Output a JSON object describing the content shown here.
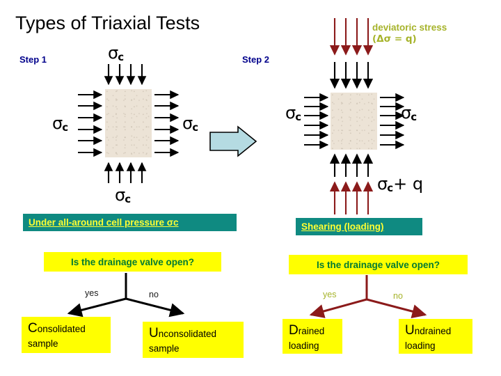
{
  "slide": {
    "title": "Types of Triaxial Tests",
    "background": "#ffffff"
  },
  "colors": {
    "title_text": "#000000",
    "step_label": "#00008b",
    "sample_fill": "#ece3d6",
    "black_arrow": "#000000",
    "dark_red_arrow": "#8b1a1a",
    "transition_arrow_fill": "#b5dbe2",
    "banner_bg": "#0f8a81",
    "banner_text": "#ffff33",
    "question_bg": "#ffff00",
    "question_text": "#007a33",
    "leaf_bg": "#ffff00",
    "leaf_text": "#000000",
    "deviatoric_text": "#a6b32a"
  },
  "step1": {
    "label": "Step 1",
    "sigma_top": "σc",
    "sigma_left": "σc",
    "sigma_right": "σc",
    "sigma_bottom": "σc",
    "top_arrow_count": 4,
    "side_arrow_count": 6,
    "bottom_arrow_count": 4,
    "arrow_color": "#000000"
  },
  "step2": {
    "label": "Step 2",
    "sigma_left": "σc",
    "sigma_right": "σc",
    "sigma_bottom": "σc+ q",
    "deviatoric_line1": "deviatoric stress",
    "deviatoric_line2": "(Δσ = q)",
    "top_red_arrow_count": 4,
    "top_black_arrow_count": 4,
    "side_arrow_count": 6,
    "bottom_black_arrow_count": 4,
    "bottom_red_arrow_count": 4
  },
  "transition_arrow": {
    "name": "right-arrow-shape",
    "fill": "#b5dbe2",
    "stroke": "#000000"
  },
  "flow_left": {
    "banner": "Under all-around cell pressure σc",
    "question": "Is the drainage valve open?",
    "branch_yes": "yes",
    "branch_no": "no",
    "leaf_yes": {
      "cap": "C",
      "rest": "onsolidated",
      "line2": "sample"
    },
    "leaf_no": {
      "cap": "U",
      "rest": "nconsolidated",
      "line2": "sample"
    },
    "arrow_color": "#000000",
    "branch_text_color": "#1a1a1a"
  },
  "flow_right": {
    "banner": "Shearing (loading)",
    "question": "Is the drainage valve open?",
    "branch_yes": "yes",
    "branch_no": "no",
    "leaf_yes": {
      "cap": "D",
      "rest": "rained",
      "line2": "loading"
    },
    "leaf_no": {
      "cap": "U",
      "rest": "ndrained",
      "line2": "loading"
    },
    "arrow_color": "#8b1a1a",
    "branch_text_color": "#a6b32a"
  }
}
